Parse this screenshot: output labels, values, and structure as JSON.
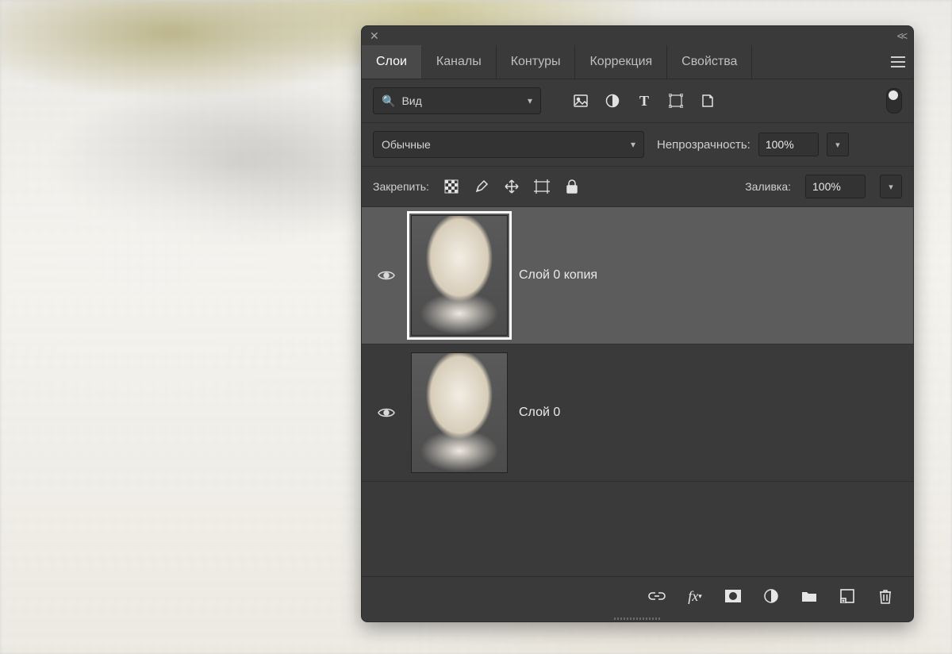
{
  "tabs": {
    "items": [
      "Слои",
      "Каналы",
      "Контуры",
      "Коррекция",
      "Свойства"
    ],
    "active_index": 0
  },
  "filterRow": {
    "kind_label": "Вид",
    "icons": [
      "image-icon",
      "adjustment-icon",
      "type-icon",
      "shape-icon",
      "smartobject-icon"
    ]
  },
  "blendRow": {
    "mode": "Обычные",
    "opacity_label": "Непрозрачность:",
    "opacity_value": "100%"
  },
  "lockRow": {
    "label": "Закрепить:",
    "fill_label": "Заливка:",
    "fill_value": "100%"
  },
  "layers": [
    {
      "name": "Слой 0 копия",
      "visible": true,
      "selected": true
    },
    {
      "name": "Слой 0",
      "visible": true,
      "selected": false
    }
  ],
  "footer_icons": [
    "link-icon",
    "fx-icon",
    "mask-icon",
    "adjustmentlayer-icon",
    "group-icon",
    "newlayer-icon",
    "trash-icon"
  ]
}
